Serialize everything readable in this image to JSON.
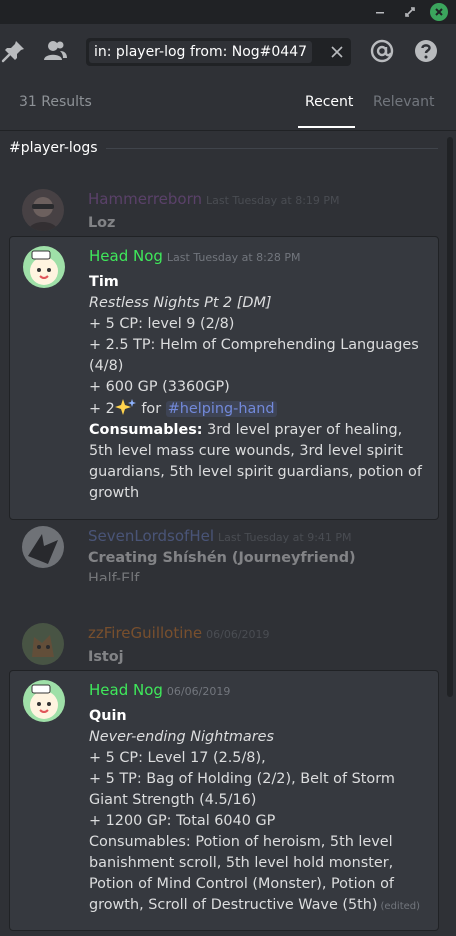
{
  "colors": {
    "background": "#2f3136",
    "titlebar": "#202225",
    "hit_bg": "#36393f",
    "nog_green": "#3fe85b",
    "mention_blue": "#7289da"
  },
  "titlebar": {
    "minimize_icon": "minimize-icon",
    "maximize_icon": "maximize-icon",
    "close_icon": "close-icon"
  },
  "toolbar": {
    "pin_icon": "pin-icon",
    "members_icon": "members-icon",
    "search_chip_1": "in: player-logs",
    "search_chip_2": "from:  Nog#0447",
    "clear_icon": "close-icon",
    "mention_icon": "at-icon",
    "help_icon": "help-icon"
  },
  "results_bar": {
    "count": "31 Results",
    "tab_recent": "Recent",
    "tab_relevant": "Relevant"
  },
  "results": {
    "channel": "#player-logs",
    "messages": [
      {
        "author": "Hammerreborn",
        "author_color": "#9b59b6",
        "time": "Last Tuesday at 8:19 PM",
        "lines": [
          "Loz"
        ]
      },
      {
        "author": "Head Nog",
        "author_color": "#3fe85b",
        "time": "Last Tuesday at 8:28 PM",
        "title": "Tim",
        "subtitle": "Restless Nights Pt 2 [DM]",
        "line1": "+ 5 CP: level 9 (2/8)",
        "line2": "+ 2.5 TP: Helm of Comprehending Languages (4/8)",
        "line3": "+ 600 GP (3360GP)",
        "line4_prefix": "+ 2",
        "line4_for": " for ",
        "line4_channel": "#helping-hand",
        "consumables_label": "Consumables:",
        "consumables": " 3rd level prayer of healing, 5th level mass cure wounds, 3rd level spirit guardians, 5th level spirit guardians, potion of growth"
      },
      {
        "author": "SevenLordsofHel",
        "author_color": "#7289da",
        "time": "Last Tuesday at 9:41 PM",
        "title": "Creating Shíshén (Journeyfriend)",
        "partial": "Half-Elf"
      },
      {
        "author": "zzFireGuillotine",
        "author_color": "#e67e22",
        "time": "06/06/2019",
        "title": "Istoj"
      },
      {
        "author": "Head Nog",
        "author_color": "#3fe85b",
        "time": "06/06/2019",
        "title": "Quin",
        "subtitle": "Never-ending Nightmares",
        "line1": "+ 5 CP: Level 17 (2.5/8),",
        "line2": "+ 5 TP: Bag of Holding (2/2), Belt of Storm Giant Strength (4.5/16)",
        "line3": "+ 1200 GP: Total 6040 GP",
        "consumables": "Consumables: Potion of heroism, 5th level banishment scroll, 5th level hold monster, Potion of Mind Control (Monster), Potion of growth, Scroll of Destructive Wave (5th)",
        "edited": "(edited)"
      }
    ]
  }
}
